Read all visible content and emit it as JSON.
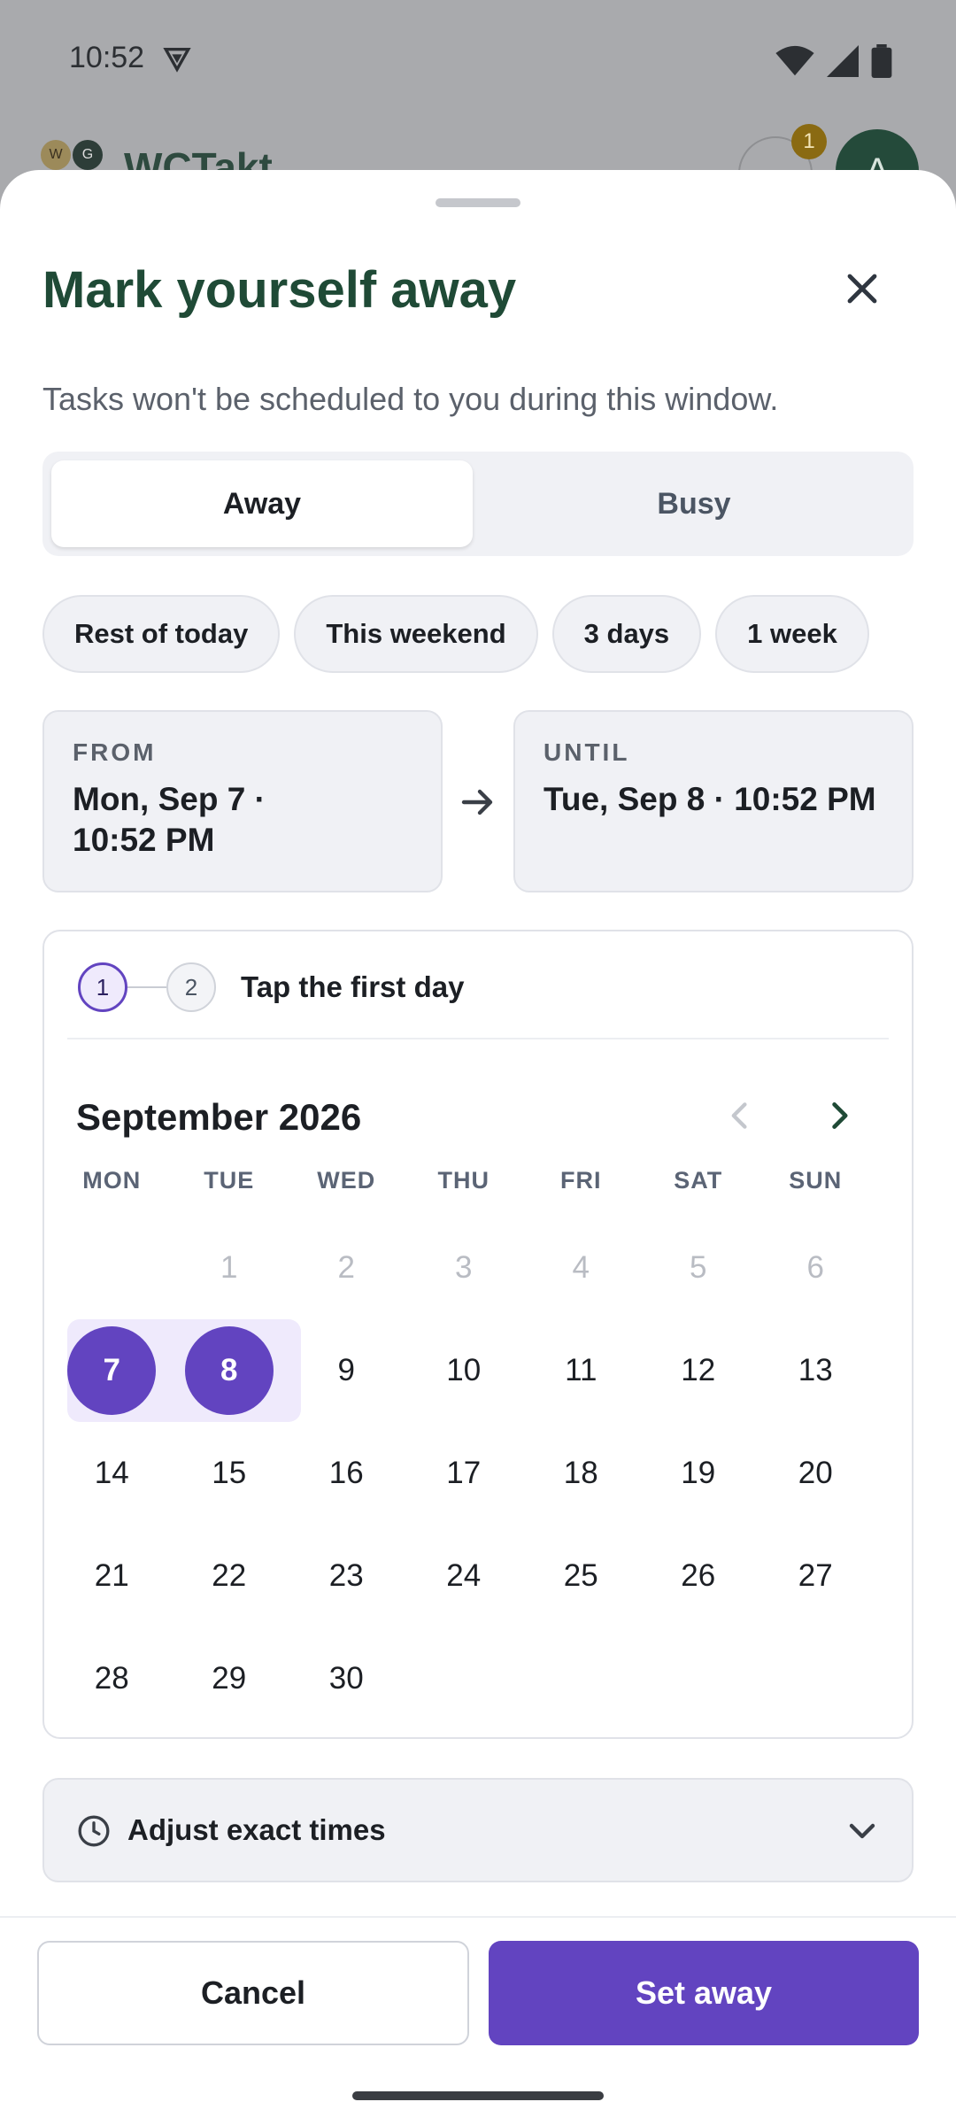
{
  "status_bar": {
    "time": "10:52"
  },
  "background_app": {
    "logo_w": "W",
    "logo_g": "G",
    "title": "WCTakt",
    "notification_count": "1",
    "avatar_initial": "A"
  },
  "sheet": {
    "title": "Mark yourself away",
    "subtitle": "Tasks won't be scheduled to you during this window.",
    "mode_tabs": [
      {
        "label": "Away",
        "selected": true
      },
      {
        "label": "Busy",
        "selected": false
      }
    ],
    "presets": [
      "Rest of today",
      "This weekend",
      "3 days",
      "1 week"
    ],
    "from": {
      "label": "FROM",
      "value_line1": "Mon, Sep 7 ·",
      "value_line2": "10:52 PM"
    },
    "until": {
      "label": "UNTIL",
      "value": "Tue, Sep 8 · 10:52 PM"
    },
    "calendar": {
      "step1": "1",
      "step2": "2",
      "instruction": "Tap the first day",
      "month_label": "September 2026",
      "weekdays": [
        "MON",
        "TUE",
        "WED",
        "THU",
        "FRI",
        "SAT",
        "SUN"
      ],
      "weeks": [
        [
          "",
          "1",
          "2",
          "3",
          "4",
          "5",
          "6"
        ],
        [
          "7",
          "8",
          "9",
          "10",
          "11",
          "12",
          "13"
        ],
        [
          "14",
          "15",
          "16",
          "17",
          "18",
          "19",
          "20"
        ],
        [
          "21",
          "22",
          "23",
          "24",
          "25",
          "26",
          "27"
        ],
        [
          "28",
          "29",
          "30",
          "",
          "",
          "",
          ""
        ]
      ],
      "disabled_days": [
        "1",
        "2",
        "3",
        "4",
        "5",
        "6"
      ],
      "selected_days": [
        "7",
        "8"
      ]
    },
    "adjust_times_label": "Adjust exact times",
    "cancel_label": "Cancel",
    "confirm_label": "Set away"
  },
  "colors": {
    "accent": "#6244c0",
    "title_green": "#1f4a36",
    "range_bg": "#efeafc"
  }
}
